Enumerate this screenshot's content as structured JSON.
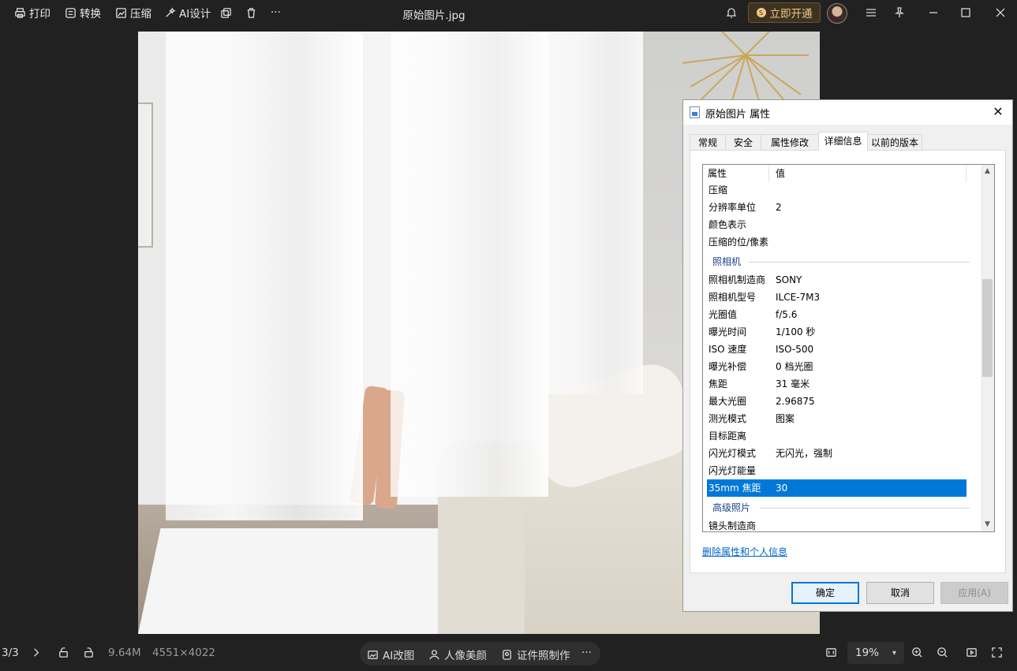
{
  "toolbar": {
    "print": "打印",
    "convert": "转换",
    "compress": "压缩",
    "ai_design": "AI设计",
    "more": "···",
    "file_title": "原始图片.jpg",
    "vip_label": "立即开通"
  },
  "dialog": {
    "title": "原始图片 属性",
    "close": "✕",
    "tabs": [
      "常规",
      "安全",
      "属性修改",
      "详细信息",
      "以前的版本"
    ],
    "active_tab": "详细信息",
    "header": {
      "property": "属性",
      "value": "值"
    },
    "rows_top": [
      {
        "k": "压缩",
        "v": ""
      },
      {
        "k": "分辨率单位",
        "v": "2"
      },
      {
        "k": "颜色表示",
        "v": ""
      },
      {
        "k": "压缩的位/像素",
        "v": ""
      }
    ],
    "section_camera": "照相机",
    "rows_camera": [
      {
        "k": "照相机制造商",
        "v": "SONY"
      },
      {
        "k": "照相机型号",
        "v": "ILCE-7M3"
      },
      {
        "k": "光圈值",
        "v": "f/5.6"
      },
      {
        "k": "曝光时间",
        "v": "1/100 秒"
      },
      {
        "k": "ISO 速度",
        "v": "ISO-500"
      },
      {
        "k": "曝光补偿",
        "v": "0 档光圈"
      },
      {
        "k": "焦距",
        "v": "31 毫米"
      },
      {
        "k": "最大光圈",
        "v": "2.96875"
      },
      {
        "k": "测光模式",
        "v": "图案"
      },
      {
        "k": "目标距离",
        "v": ""
      },
      {
        "k": "闪光灯模式",
        "v": "无闪光，强制"
      },
      {
        "k": "闪光灯能量",
        "v": ""
      },
      {
        "k": "35mm 焦距",
        "v": "30"
      }
    ],
    "section_advanced": "高级照片",
    "rows_advanced": [
      {
        "k": "镜头制造商",
        "v": ""
      }
    ],
    "remove_link": "删除属性和个人信息",
    "ok": "确定",
    "cancel": "取消",
    "apply": "应用(A)"
  },
  "bottombar": {
    "page": "3/3",
    "size": "9.64M",
    "dimensions": "4551×4022",
    "ai_edit": "AI改图",
    "portrait": "人像美颜",
    "id_photo": "证件照制作",
    "more": "···",
    "zoom": "19%"
  }
}
